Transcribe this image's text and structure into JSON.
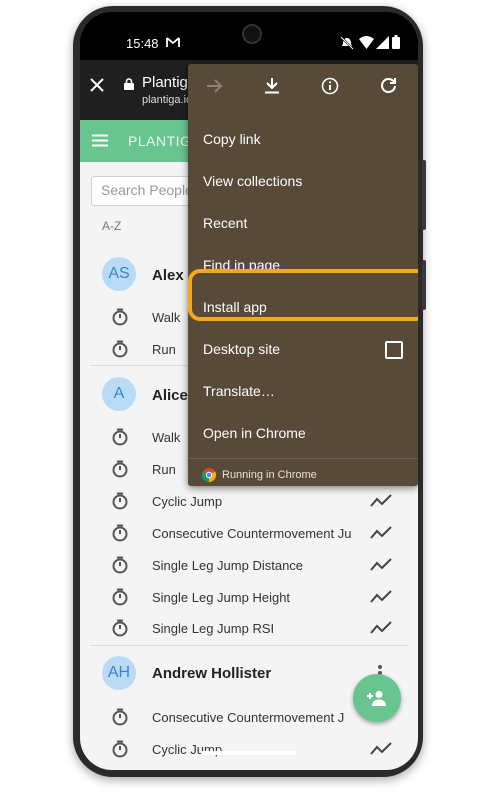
{
  "status_bar": {
    "time": "15:48",
    "mail_icon": "gmail-icon",
    "icons": [
      "mute-icon",
      "wifi-icon",
      "signal-icon",
      "battery-icon"
    ]
  },
  "chrome_bar": {
    "site_title": "Plantiga",
    "site_url": "plantiga.io"
  },
  "app_bar": {
    "title": "PLANTIGA"
  },
  "search": {
    "placeholder": "Search People"
  },
  "list_header": "A-Z",
  "people": [
    {
      "initials": "AS",
      "name": "Alex S",
      "activities": [
        {
          "label": "Walk"
        },
        {
          "label": "Run"
        }
      ]
    },
    {
      "initials": "A",
      "name": "Alice",
      "activities": [
        {
          "label": "Walk"
        },
        {
          "label": "Run"
        },
        {
          "label": "Cyclic Jump"
        },
        {
          "label": "Consecutive Countermovement Ju"
        },
        {
          "label": "Single Leg Jump Distance"
        },
        {
          "label": "Single Leg Jump Height"
        },
        {
          "label": "Single Leg Jump RSI"
        }
      ]
    },
    {
      "initials": "AH",
      "name": "Andrew Hollister",
      "activities": [
        {
          "label": "Consecutive Countermovement J"
        },
        {
          "label": "Cyclic Jump"
        }
      ]
    }
  ],
  "menu": {
    "toolbar_icons": [
      "forward-icon",
      "download-icon",
      "info-icon",
      "refresh-icon"
    ],
    "items": [
      "Copy link",
      "View collections",
      "Recent",
      "Find in page",
      "Install app",
      "Desktop site",
      "Translate…",
      "Open in Chrome"
    ],
    "footer": "Running in Chrome"
  },
  "colors": {
    "brand_green": "#69c58f",
    "menu_bg": "#574a39",
    "highlight": "#f5a623",
    "avatar_bg": "#b9dbf6"
  }
}
